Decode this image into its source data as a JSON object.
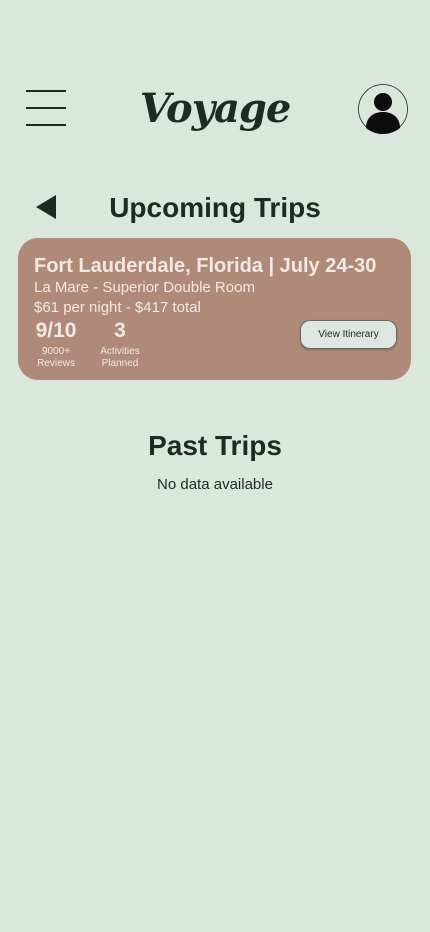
{
  "header": {
    "logo": "Voyage",
    "menu_icon": "hamburger-menu-icon",
    "profile_icon": "user-avatar-icon"
  },
  "upcoming": {
    "back_icon": "back-arrow-icon",
    "title": "Upcoming Trips",
    "trips": [
      {
        "title": "Fort Lauderdale, Florida | July 24-30",
        "room": "La Mare - Superior Double Room",
        "price": "$61 per night - $417 total",
        "rating": "9/10",
        "rating_label_line1": "9000+",
        "rating_label_line2": "Reviews",
        "activities": "3",
        "activities_label_line1": "Activities",
        "activities_label_line2": "Planned",
        "button_label": "View Itinerary"
      }
    ]
  },
  "past": {
    "title": "Past Trips",
    "empty_text": "No data available"
  },
  "colors": {
    "background": "#dbe6dd",
    "card": "#b08a78",
    "card_text": "#f2e8e4",
    "text": "#1e2a22"
  }
}
